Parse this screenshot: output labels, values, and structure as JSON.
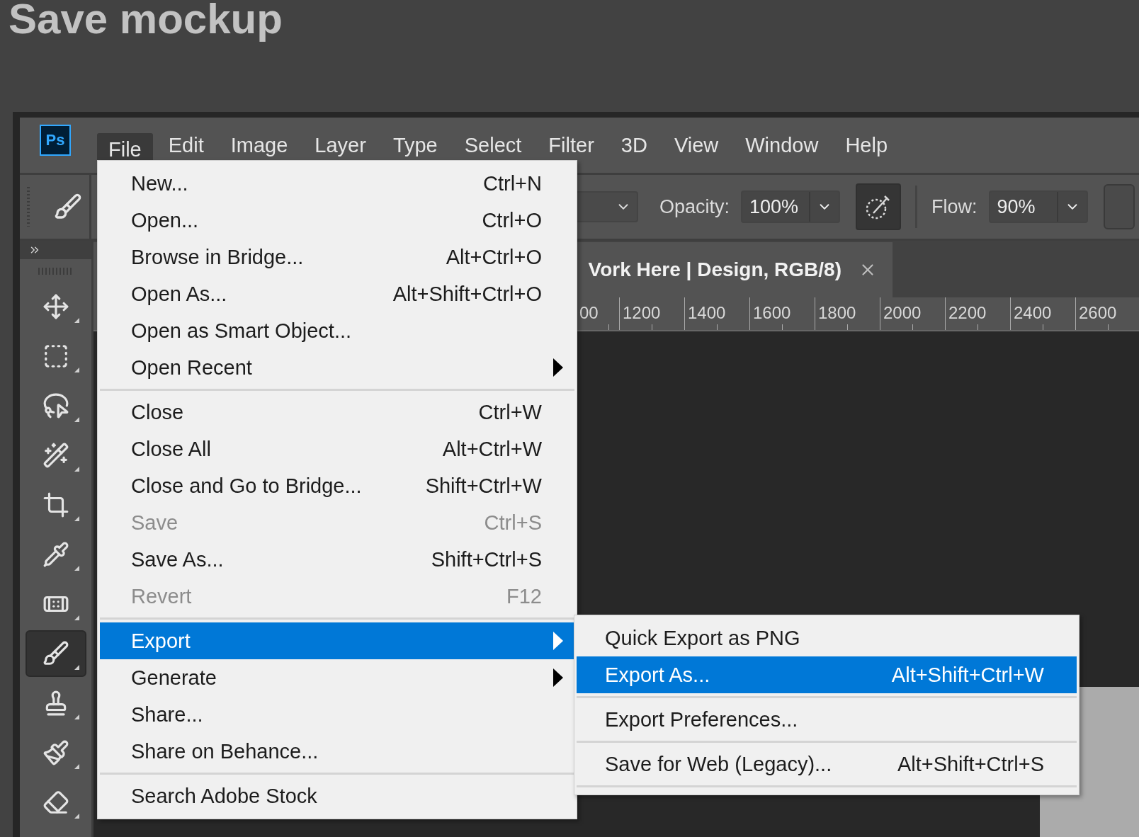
{
  "page_title": "Save mockup",
  "app": {
    "logo": "Ps",
    "menu_bar": [
      {
        "label": "File",
        "selected": true
      },
      {
        "label": "Edit",
        "selected": false
      },
      {
        "label": "Image",
        "selected": false
      },
      {
        "label": "Layer",
        "selected": false
      },
      {
        "label": "Type",
        "selected": false
      },
      {
        "label": "Select",
        "selected": false
      },
      {
        "label": "Filter",
        "selected": false
      },
      {
        "label": "3D",
        "selected": false
      },
      {
        "label": "View",
        "selected": false
      },
      {
        "label": "Window",
        "selected": false
      },
      {
        "label": "Help",
        "selected": false
      }
    ],
    "options_bar": {
      "opacity_label": "Opacity:",
      "opacity_value": "100%",
      "flow_label": "Flow:",
      "flow_value": "90%"
    },
    "toolbar": {
      "tools": [
        {
          "selected": false
        },
        {
          "selected": false
        },
        {
          "selected": false
        },
        {
          "selected": false
        },
        {
          "selected": false
        },
        {
          "selected": false
        },
        {
          "selected": false
        },
        {
          "selected": true
        },
        {
          "selected": false
        },
        {
          "selected": false
        },
        {
          "selected": false
        }
      ]
    },
    "document": {
      "tab_title": "Vork Here | Design, RGB/8)",
      "ruler_labels": [
        "00",
        "1200",
        "1400",
        "1600",
        "1800",
        "2000",
        "2200",
        "2400",
        "2600"
      ]
    },
    "file_menu": {
      "groups": [
        {
          "items": [
            {
              "label": "New...",
              "shortcut": "Ctrl+N",
              "disabled": false,
              "selected": false,
              "submenu": false
            },
            {
              "label": "Open...",
              "shortcut": "Ctrl+O",
              "disabled": false,
              "selected": false,
              "submenu": false
            },
            {
              "label": "Browse in Bridge...",
              "shortcut": "Alt+Ctrl+O",
              "disabled": false,
              "selected": false,
              "submenu": false
            },
            {
              "label": "Open As...",
              "shortcut": "Alt+Shift+Ctrl+O",
              "disabled": false,
              "selected": false,
              "submenu": false
            },
            {
              "label": "Open as Smart Object...",
              "disabled": false,
              "selected": false,
              "submenu": false
            },
            {
              "label": "Open Recent",
              "disabled": false,
              "selected": false,
              "submenu": true
            }
          ]
        },
        {
          "items": [
            {
              "label": "Close",
              "shortcut": "Ctrl+W",
              "disabled": false,
              "selected": false,
              "submenu": false
            },
            {
              "label": "Close All",
              "shortcut": "Alt+Ctrl+W",
              "disabled": false,
              "selected": false,
              "submenu": false
            },
            {
              "label": "Close and Go to Bridge...",
              "shortcut": "Shift+Ctrl+W",
              "disabled": false,
              "selected": false,
              "submenu": false
            },
            {
              "label": "Save",
              "shortcut": "Ctrl+S",
              "disabled": true,
              "selected": false,
              "submenu": false
            },
            {
              "label": "Save As...",
              "shortcut": "Shift+Ctrl+S",
              "disabled": false,
              "selected": false,
              "submenu": false
            },
            {
              "label": "Revert",
              "shortcut": "F12",
              "disabled": true,
              "selected": false,
              "submenu": false
            }
          ]
        },
        {
          "items": [
            {
              "label": "Export",
              "disabled": false,
              "selected": true,
              "submenu": true
            },
            {
              "label": "Generate",
              "disabled": false,
              "selected": false,
              "submenu": true
            },
            {
              "label": "Share...",
              "disabled": false,
              "selected": false,
              "submenu": false
            },
            {
              "label": "Share on Behance...",
              "disabled": false,
              "selected": false,
              "submenu": false
            }
          ]
        },
        {
          "items": [
            {
              "label": "Search Adobe Stock",
              "disabled": false,
              "selected": false,
              "submenu": false
            }
          ]
        }
      ]
    },
    "export_submenu": {
      "groups": [
        {
          "items": [
            {
              "label": "Quick Export as PNG",
              "disabled": false,
              "selected": false,
              "submenu": false
            },
            {
              "label": "Export As...",
              "shortcut": "Alt+Shift+Ctrl+W",
              "disabled": false,
              "selected": true,
              "submenu": false
            }
          ]
        },
        {
          "items": [
            {
              "label": "Export Preferences...",
              "disabled": false,
              "selected": false,
              "submenu": false
            }
          ]
        },
        {
          "items": [
            {
              "label": "Save for Web (Legacy)...",
              "shortcut": "Alt+Shift+Ctrl+S",
              "disabled": false,
              "selected": false,
              "submenu": false
            }
          ]
        }
      ]
    }
  }
}
